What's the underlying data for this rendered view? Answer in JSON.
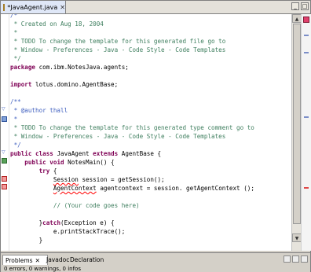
{
  "editor_tab": {
    "title": "*JavaAgent.java",
    "close_glyph": "✕"
  },
  "code_lines": [
    {
      "segments": [
        {
          "cls": "jd",
          "text": "/*"
        }
      ]
    },
    {
      "segments": [
        {
          "cls": "cm",
          "text": " * Created on Aug 18, 2004"
        }
      ]
    },
    {
      "segments": [
        {
          "cls": "cm",
          "text": " *"
        }
      ]
    },
    {
      "segments": [
        {
          "cls": "cm",
          "text": " * TODO To change the template for this generated file go to"
        }
      ]
    },
    {
      "segments": [
        {
          "cls": "cm",
          "text": " * Window - Preferences - Java - Code Style - Code Templates"
        }
      ]
    },
    {
      "segments": [
        {
          "cls": "cm",
          "text": " */"
        }
      ]
    },
    {
      "segments": [
        {
          "cls": "kw",
          "text": "package"
        },
        {
          "cls": "tx",
          "text": " com.ibm.NotesJava.agents;"
        }
      ]
    },
    {
      "segments": []
    },
    {
      "segments": [
        {
          "cls": "kw",
          "text": "import"
        },
        {
          "cls": "tx",
          "text": " lotus.domino.AgentBase;"
        }
      ]
    },
    {
      "segments": []
    },
    {
      "segments": [
        {
          "cls": "jd",
          "text": "/**"
        }
      ]
    },
    {
      "segments": [
        {
          "cls": "jd",
          "text": " * @author thall"
        }
      ]
    },
    {
      "segments": [
        {
          "cls": "jd",
          "text": " *"
        }
      ]
    },
    {
      "segments": [
        {
          "cls": "cm",
          "text": " * TODO To change the template for this generated type comment go to"
        }
      ]
    },
    {
      "segments": [
        {
          "cls": "cm",
          "text": " * Window - Preferences - Java - Code Style - Code Templates"
        }
      ]
    },
    {
      "segments": [
        {
          "cls": "jd",
          "text": " */"
        }
      ]
    },
    {
      "segments": [
        {
          "cls": "kw",
          "text": "public class"
        },
        {
          "cls": "tx",
          "text": " JavaAgent "
        },
        {
          "cls": "kw",
          "text": "extends"
        },
        {
          "cls": "tx",
          "text": " AgentBase {"
        }
      ]
    },
    {
      "segments": [
        {
          "cls": "tx",
          "text": "    "
        },
        {
          "cls": "kw",
          "text": "public void"
        },
        {
          "cls": "tx",
          "text": " NotesMain() {"
        }
      ]
    },
    {
      "segments": [
        {
          "cls": "tx",
          "text": "        "
        },
        {
          "cls": "kw",
          "text": "try"
        },
        {
          "cls": "tx",
          "text": " {"
        }
      ]
    },
    {
      "segments": [
        {
          "cls": "tx",
          "text": "            "
        },
        {
          "cls": "tx err",
          "text": "Session"
        },
        {
          "cls": "tx",
          "text": " session = getSession();"
        }
      ]
    },
    {
      "segments": [
        {
          "cls": "tx",
          "text": "            "
        },
        {
          "cls": "tx err",
          "text": "AgentContext"
        },
        {
          "cls": "tx",
          "text": " agentcontext = session. getAgentContext ();"
        }
      ]
    },
    {
      "segments": []
    },
    {
      "segments": [
        {
          "cls": "tx",
          "text": "            "
        },
        {
          "cls": "cm",
          "text": "// (Your code goes here)"
        }
      ]
    },
    {
      "segments": []
    },
    {
      "segments": [
        {
          "cls": "tx",
          "text": "        }"
        },
        {
          "cls": "kw",
          "text": "catch"
        },
        {
          "cls": "tx",
          "text": "(Exception e) {"
        }
      ]
    },
    {
      "segments": [
        {
          "cls": "tx",
          "text": "            e.printStackTrace();"
        }
      ]
    },
    {
      "segments": [
        {
          "cls": "tx",
          "text": "        }"
        }
      ]
    },
    {
      "segments": []
    },
    {
      "segments": [
        {
          "cls": "tx",
          "text": "    }"
        }
      ]
    }
  ],
  "bottom_tabs": [
    {
      "label": "Problems",
      "active": true,
      "close_glyph": "✕"
    },
    {
      "label": "Javadoc",
      "active": false
    },
    {
      "label": "Declaration",
      "active": false
    }
  ],
  "status": "0 errors, 0 warnings, 0 infos",
  "colors": {
    "keyword": "#7f0055",
    "comment": "#3f7f5f",
    "javadoc": "#3f5fbf",
    "error_underline": "#ff0000"
  }
}
